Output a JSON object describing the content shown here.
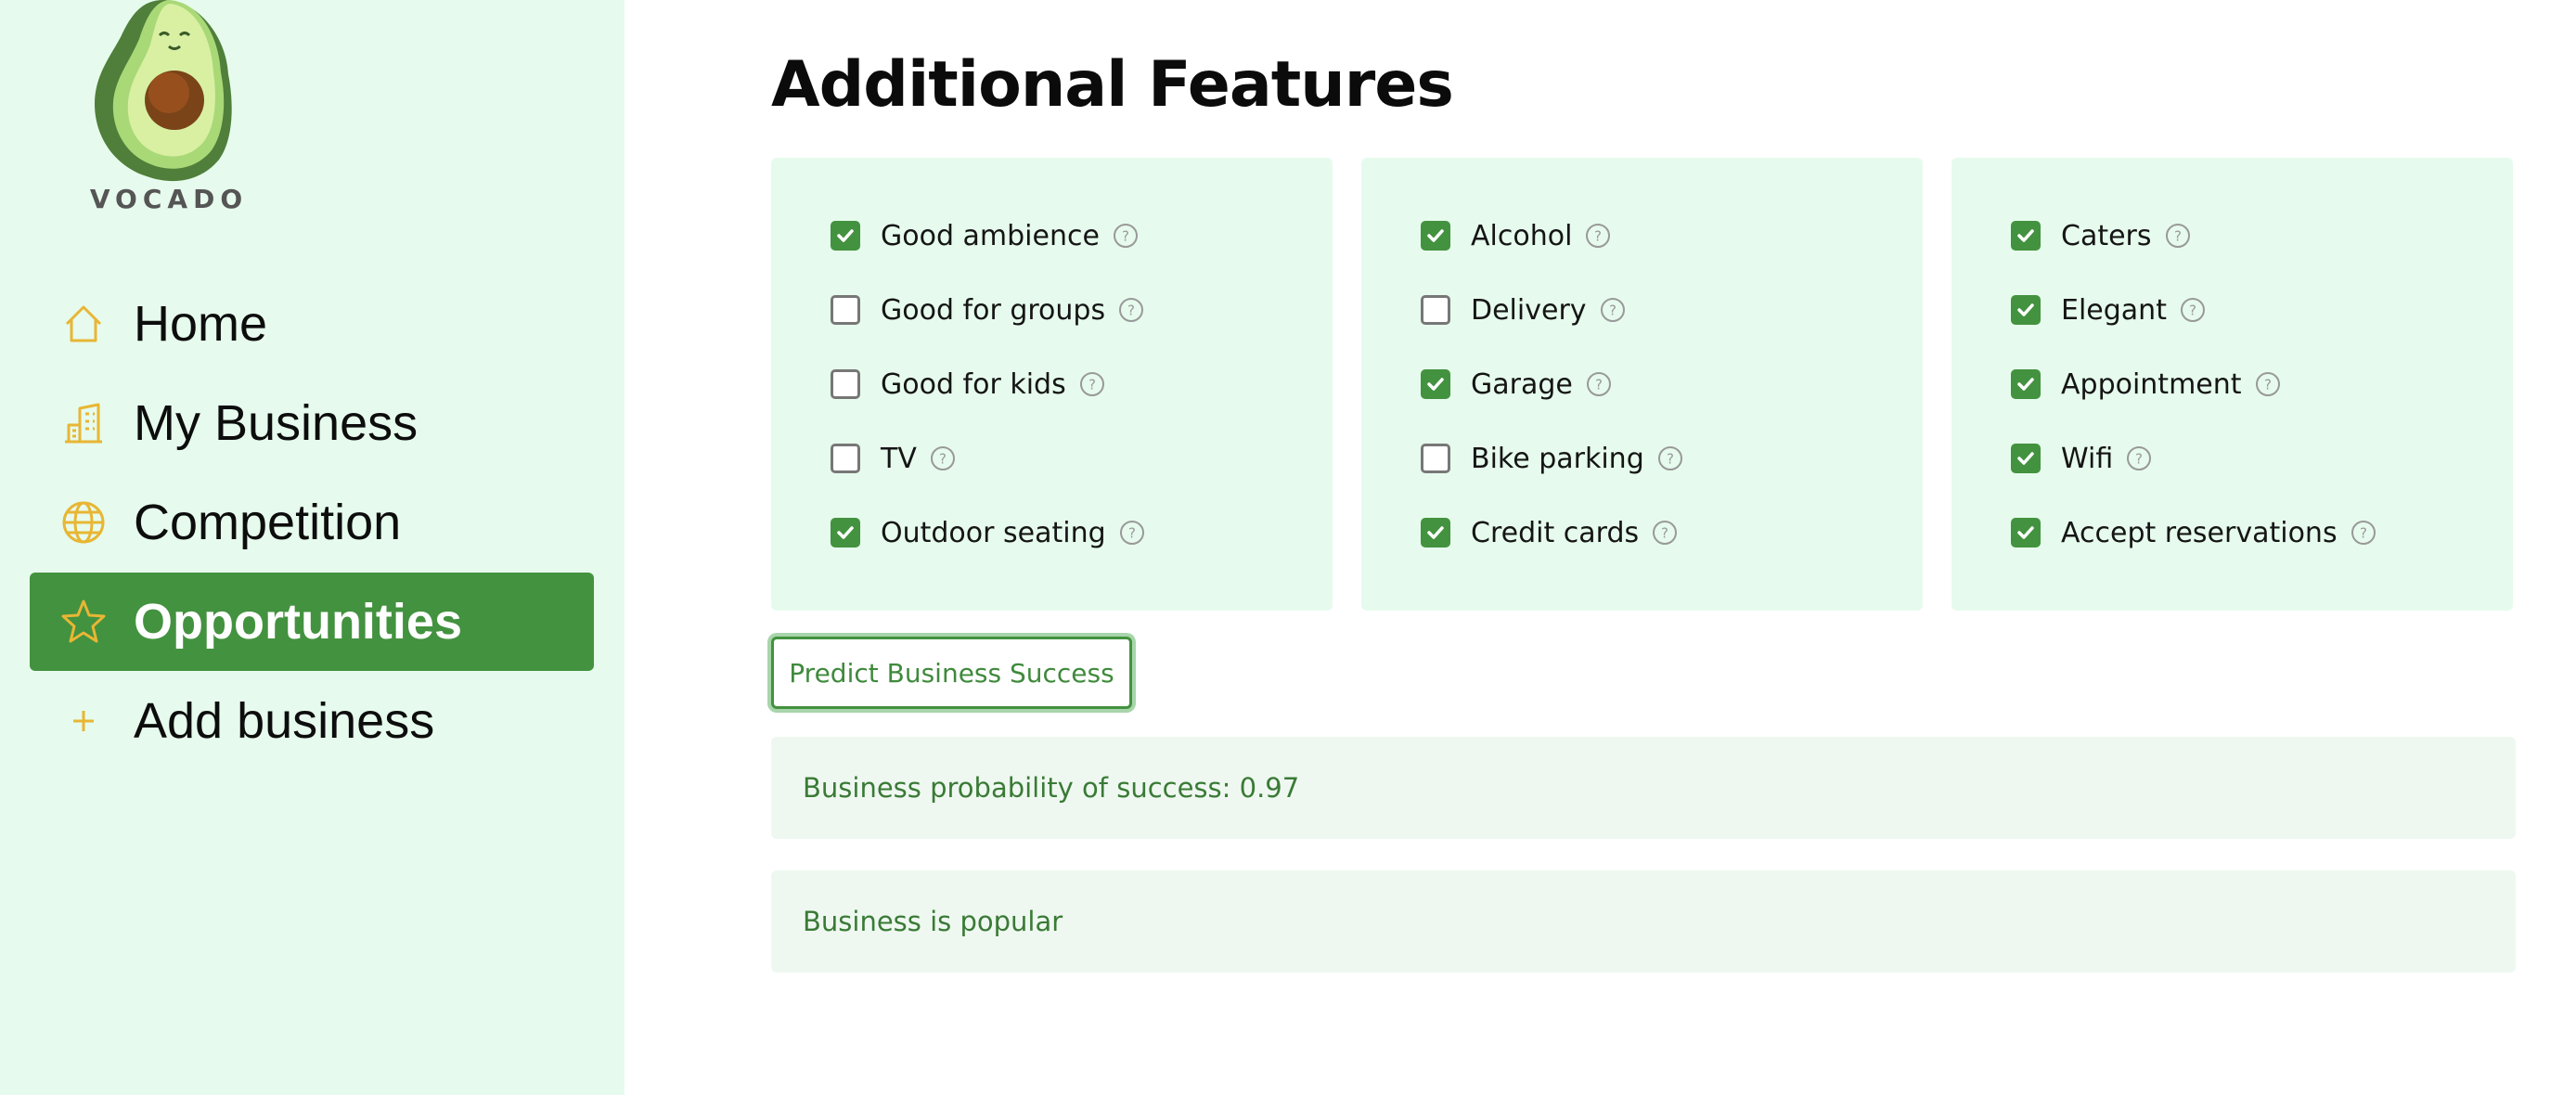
{
  "brand": {
    "name": "VOCADO"
  },
  "nav": {
    "items": [
      {
        "label": "Home",
        "icon": "home-icon",
        "active": false
      },
      {
        "label": "My Business",
        "icon": "building-icon",
        "active": false
      },
      {
        "label": "Competition",
        "icon": "globe-icon",
        "active": false
      },
      {
        "label": "Opportunities",
        "icon": "star-icon",
        "active": true
      },
      {
        "label": "Add business",
        "icon": "plus-icon",
        "active": false
      }
    ]
  },
  "page": {
    "title": "Additional Features"
  },
  "features": {
    "col1": [
      {
        "label": "Good ambience",
        "checked": true
      },
      {
        "label": "Good for groups",
        "checked": false
      },
      {
        "label": "Good for kids",
        "checked": false
      },
      {
        "label": "TV",
        "checked": false
      },
      {
        "label": "Outdoor seating",
        "checked": true
      }
    ],
    "col2": [
      {
        "label": "Alcohol",
        "checked": true
      },
      {
        "label": "Delivery",
        "checked": false
      },
      {
        "label": "Garage",
        "checked": true
      },
      {
        "label": "Bike parking",
        "checked": false
      },
      {
        "label": "Credit cards",
        "checked": true
      }
    ],
    "col3": [
      {
        "label": "Caters",
        "checked": true
      },
      {
        "label": "Elegant",
        "checked": true
      },
      {
        "label": "Appointment",
        "checked": true
      },
      {
        "label": "Wifi",
        "checked": true
      },
      {
        "label": "Accept reservations",
        "checked": true
      }
    ]
  },
  "actions": {
    "predict_label": "Predict Business Success"
  },
  "results": {
    "probability_text": "Business probability of success: 0.97",
    "status_text": "Business is popular"
  },
  "colors": {
    "accent": "#43923f",
    "sidebar_bg": "#e6fbed",
    "icon_gold": "#e8b634",
    "result_bg": "#eef8f0",
    "result_text": "#3a7a36"
  }
}
